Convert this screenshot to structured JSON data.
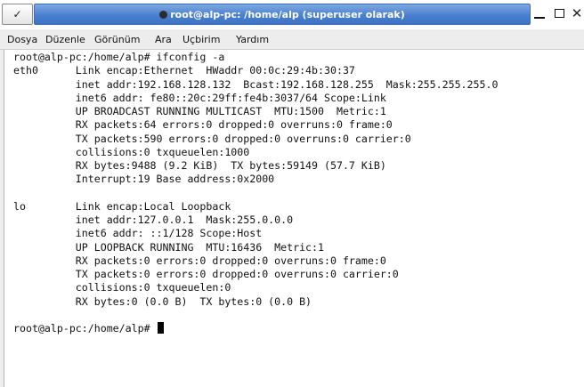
{
  "window": {
    "title": "root@alp-pc: /home/alp (superuser olarak)",
    "menu_icon": "chevron-down-icon",
    "controls": [
      "minimize-icon",
      "maximize-icon",
      "close-icon"
    ]
  },
  "menubar": {
    "items": [
      "Dosya",
      "Düzenle",
      "Görünüm",
      "Ara",
      "Uçbirim",
      "Yardım"
    ]
  },
  "terminal": {
    "output": "root@alp-pc:/home/alp# ifconfig -a\neth0      Link encap:Ethernet  HWaddr 00:0c:29:4b:30:37\n          inet addr:192.168.128.132  Bcast:192.168.128.255  Mask:255.255.255.0\n          inet6 addr: fe80::20c:29ff:fe4b:3037/64 Scope:Link\n          UP BROADCAST RUNNING MULTICAST  MTU:1500  Metric:1\n          RX packets:64 errors:0 dropped:0 overruns:0 frame:0\n          TX packets:590 errors:0 dropped:0 overruns:0 carrier:0\n          collisions:0 txqueuelen:1000\n          RX bytes:9488 (9.2 KiB)  TX bytes:59149 (57.7 KiB)\n          Interrupt:19 Base address:0x2000\n\nlo        Link encap:Local Loopback\n          inet addr:127.0.0.1  Mask:255.0.0.0\n          inet6 addr: ::1/128 Scope:Host\n          UP LOOPBACK RUNNING  MTU:16436  Metric:1\n          RX packets:0 errors:0 dropped:0 overruns:0 frame:0\n          TX packets:0 errors:0 dropped:0 overruns:0 carrier:0\n          collisions:0 txqueuelen:0\n          RX bytes:0 (0.0 B)  TX bytes:0 (0.0 B)\n\n",
    "prompt": "root@alp-pc:/home/alp# "
  },
  "colors": {
    "titlebar_active": "#4a80cf",
    "terminal_bg": "#ffffff",
    "terminal_fg": "#111111"
  }
}
